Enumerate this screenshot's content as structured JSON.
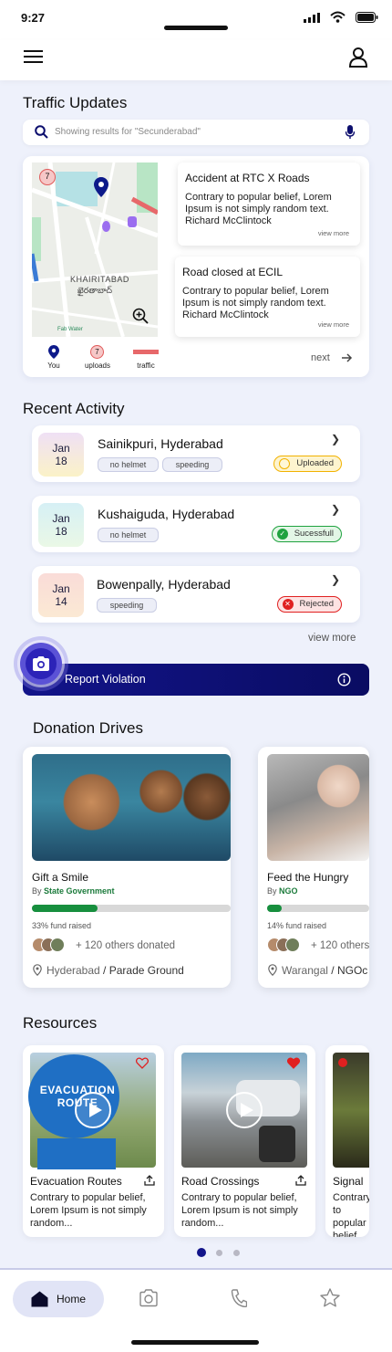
{
  "status": {
    "time": "9:27"
  },
  "traffic": {
    "title": "Traffic Updates",
    "search_placeholder": "Showing results for \"Secunderabad\"",
    "map_labels": {
      "area": "KHAIRITABAD",
      "area_local": "ఖైరతాబాద్",
      "poi": "Fab Water",
      "cluster": "7"
    },
    "legend": [
      {
        "label": "You",
        "icon": "location-pin-icon"
      },
      {
        "label": "uploads",
        "icon": "uploads-count-icon",
        "count": "7"
      },
      {
        "label": "traffic",
        "icon": "traffic-line-icon"
      }
    ],
    "news": [
      {
        "title": "Accident at RTC X Roads",
        "body": "Contrary to popular belief, Lorem Ipsum is not simply random text. Richard McClintock",
        "more": "view more"
      },
      {
        "title": "Road closed at ECIL",
        "body": "Contrary to popular belief, Lorem Ipsum is not simply random text. Richard McClintock",
        "more": "view more"
      }
    ],
    "next": "next"
  },
  "activity": {
    "title": "Recent Activity",
    "items": [
      {
        "month": "Jan",
        "day": "18",
        "place": "Sainikpuri, Hyderabad",
        "tags": [
          "no helmet",
          "speeding"
        ],
        "status": "Uploaded"
      },
      {
        "month": "Jan",
        "day": "18",
        "place": "Kushaiguda, Hyderabad",
        "tags": [
          "no helmet"
        ],
        "status": "Sucessfull"
      },
      {
        "month": "Jan",
        "day": "14",
        "place": "Bowenpally, Hyderabad",
        "tags": [
          "speeding"
        ],
        "status": "Rejected"
      }
    ],
    "view_more": "view more"
  },
  "report": {
    "label": "Report Violation"
  },
  "donations": {
    "title": "Donation Drives",
    "items": [
      {
        "name": "Gift a Smile",
        "by_prefix": "By",
        "by": "State Government",
        "progress": 0.33,
        "raised": "33% fund raised",
        "others": "+ 120 others donated",
        "city": "Hyderabad",
        "venue": "Parade Ground"
      },
      {
        "name": "Feed the Hungry",
        "by_prefix": "By",
        "by": "NGO",
        "progress": 0.14,
        "raised": "14% fund raised",
        "others": "+ 120 others",
        "city": "Warangal",
        "venue": "NGOc"
      }
    ]
  },
  "resources": {
    "title": "Resources",
    "items": [
      {
        "title": "Evacuation Routes",
        "body": "Contrary to popular belief, Lorem Ipsum is not simply random...",
        "sign_text": "EVACUATION ROUTE"
      },
      {
        "title": "Road Crossings",
        "body": "Contrary to popular belief, Lorem Ipsum is not simply random..."
      },
      {
        "title": "Signal",
        "body": "Contrary to popular belief, Lorem Ipsum is not simply random..."
      }
    ],
    "page_count": 3,
    "active_page": 1
  },
  "nav": {
    "home": "Home"
  },
  "colors": {
    "primary": "#0d0f6e",
    "accent_green": "#178f3e",
    "uploaded": "#f2b200",
    "success": "#1fa23f",
    "rejected": "#e02020"
  }
}
